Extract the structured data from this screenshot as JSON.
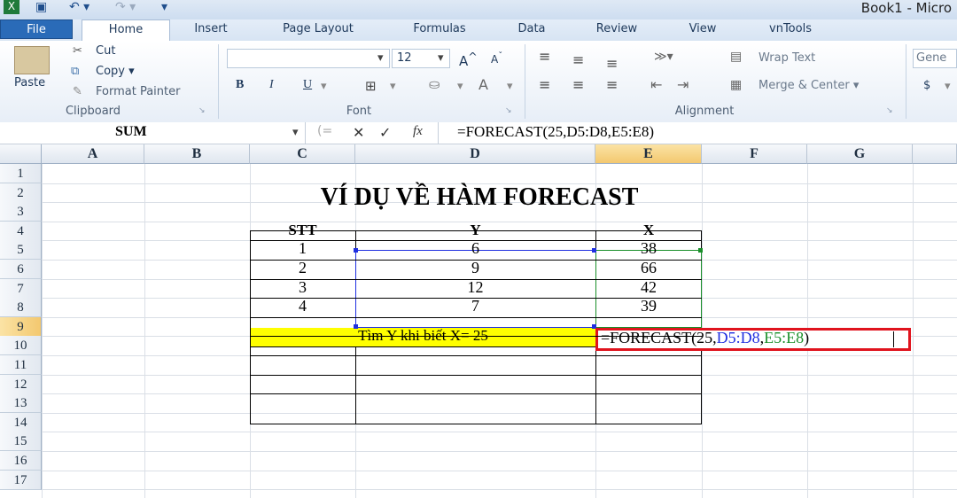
{
  "window": {
    "title": "Book1  -  Micro"
  },
  "ribbon_tabs": [
    "File",
    "Home",
    "Insert",
    "Page Layout",
    "Formulas",
    "Data",
    "Review",
    "View",
    "vnTools"
  ],
  "clipboard": {
    "paste": "Paste",
    "cut": "Cut",
    "copy": "Copy ▾",
    "format_painter": "Format Painter",
    "group": "Clipboard"
  },
  "font": {
    "size": "12",
    "group": "Font",
    "bold": "B",
    "italic": "I",
    "underline": "U"
  },
  "alignment": {
    "wrap_text": "Wrap Text",
    "merge_center": "Merge & Center ▾",
    "group": "Alignment"
  },
  "number": {
    "format": "Gene",
    "currency": "$"
  },
  "formula_bar": {
    "name_box": "SUM",
    "formula": "=FORECAST(25,D5:D8,E5:E8)",
    "fx": "fx"
  },
  "columns": [
    "A",
    "B",
    "C",
    "D",
    "E",
    "F",
    "G"
  ],
  "rows": [
    "1",
    "2",
    "3",
    "4",
    "5",
    "6",
    "7",
    "8",
    "9",
    "10",
    "11",
    "12",
    "13",
    "14",
    "15",
    "16",
    "17"
  ],
  "sheet": {
    "title": "VÍ DỤ VỀ HÀM FORECAST",
    "headers": [
      "STT",
      "Y",
      "X"
    ],
    "data": [
      [
        "1",
        "6",
        "38"
      ],
      [
        "2",
        "9",
        "66"
      ],
      [
        "3",
        "12",
        "42"
      ],
      [
        "4",
        "7",
        "39"
      ]
    ],
    "row9_label": "Tìm Y khi biết X= 25",
    "edit_formula": {
      "prefix": "=FORECAST(25,",
      "range1": "D5:D8",
      "comma": ",",
      "range2": "E5:E8",
      "suffix": ")"
    }
  },
  "colors": {
    "ref_blue": "#1f2fe0",
    "ref_green": "#1a8f2a",
    "highlight_yellow": "#ffff00",
    "edit_border": "#e0141e"
  }
}
